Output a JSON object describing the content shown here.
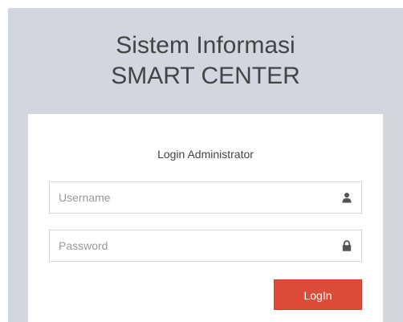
{
  "header": {
    "title_line1": "Sistem Informasi",
    "title_line2": "SMART CENTER"
  },
  "login_box": {
    "heading": "Login Administrator",
    "username": {
      "placeholder": "Username",
      "value": "",
      "icon": "user-icon"
    },
    "password": {
      "placeholder": "Password",
      "value": "",
      "icon": "lock-icon"
    },
    "submit_label": "LogIn"
  },
  "colors": {
    "background": "#d2d6de",
    "card": "#ffffff",
    "button": "#dd4b39",
    "button_text": "#ffffff",
    "text": "#444444",
    "icon": "#555555"
  }
}
